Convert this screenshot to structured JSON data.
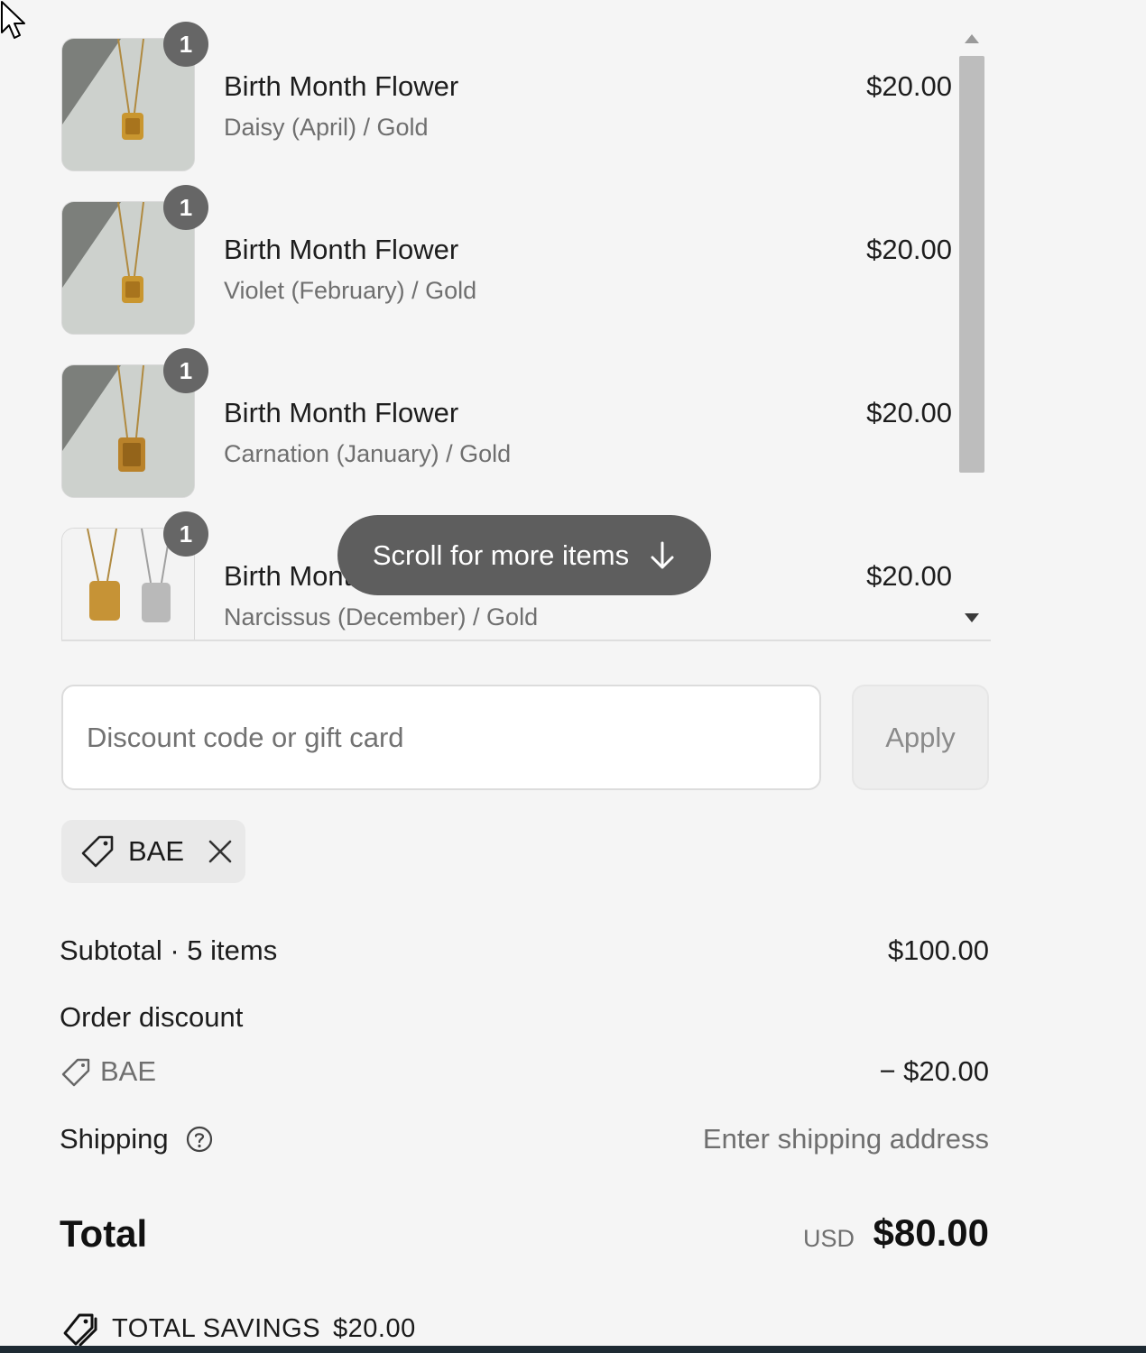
{
  "items": [
    {
      "quantity": "1",
      "title": "Birth Month Flower",
      "variant": "Daisy (April) / Gold",
      "price": "$20.00"
    },
    {
      "quantity": "1",
      "title": "Birth Month Flower",
      "variant": "Violet (February) / Gold",
      "price": "$20.00"
    },
    {
      "quantity": "1",
      "title": "Birth Month Flower",
      "variant": "Carnation (January) / Gold",
      "price": "$20.00"
    },
    {
      "quantity": "1",
      "title": "Birth Month Flower",
      "variant": "Narcissus (December) / Gold",
      "price": "$20.00"
    }
  ],
  "scroll_hint": "Scroll for more items",
  "discount": {
    "placeholder": "Discount code or gift card",
    "value": "",
    "apply_label": "Apply",
    "applied_code": "BAE"
  },
  "summary": {
    "subtotal_label": "Subtotal · 5 items",
    "subtotal_value": "$100.00",
    "order_discount_label": "Order discount",
    "discount_code": "BAE",
    "discount_value": "− $20.00",
    "shipping_label": "Shipping",
    "shipping_value": "Enter shipping address",
    "total_label": "Total",
    "total_currency": "USD",
    "total_value": "$80.00",
    "savings_label": "TOTAL SAVINGS",
    "savings_value": "$20.00"
  },
  "icons": {
    "cursor": "mouse-pointer-icon",
    "scroll": "arrow-down-icon",
    "tag": "price-tag-icon",
    "remove": "close-icon",
    "help": "question-circle-icon",
    "savings": "savings-tags-icon"
  },
  "colors": {
    "background": "#f5f5f5",
    "badge": "#666666",
    "pill": "#5e5e5e"
  }
}
